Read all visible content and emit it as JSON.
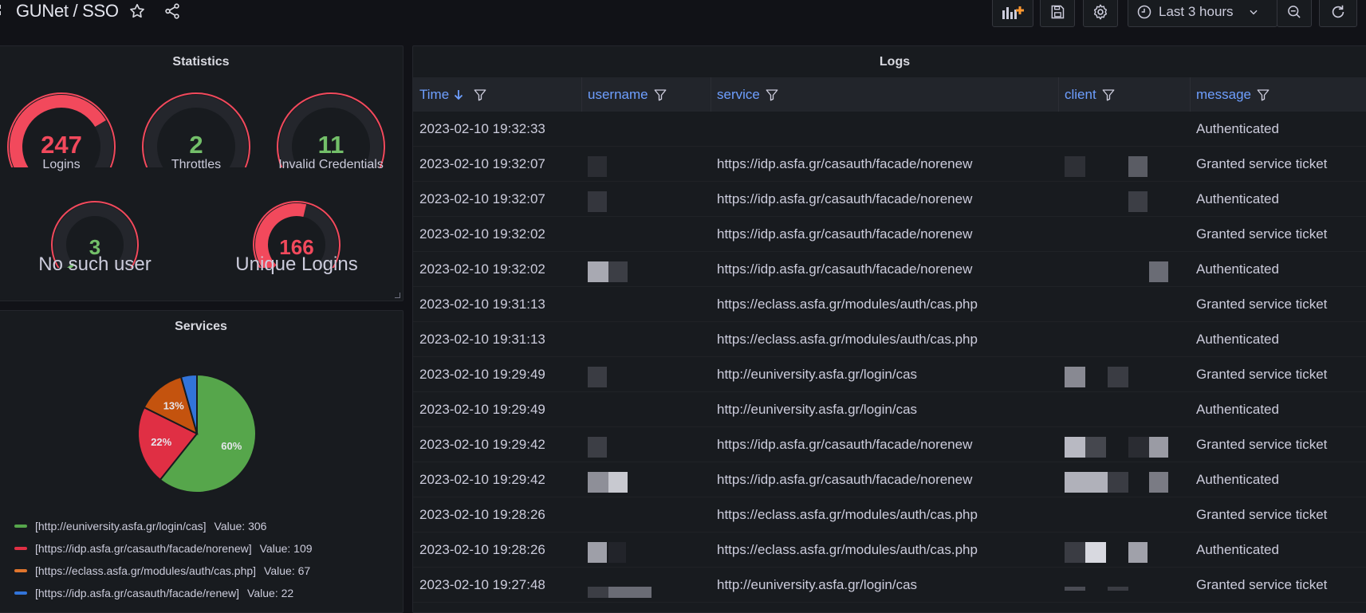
{
  "header": {
    "breadcrumb": "GUNet / SSO",
    "time_range": "Last 3 hours"
  },
  "statistics": {
    "title": "Statistics",
    "gauges": [
      {
        "value": "247",
        "label": "Logins",
        "fill": 0.72,
        "color": "#f2495c"
      },
      {
        "value": "2",
        "label": "Throttles",
        "fill": 0.02,
        "color": "#73bf69"
      },
      {
        "value": "11",
        "label": "Invalid Credentials",
        "fill": 0.05,
        "color": "#73bf69"
      },
      {
        "value": "3",
        "label": "No such user",
        "fill": 0.02,
        "color": "#73bf69"
      },
      {
        "value": "166",
        "label": "Unique Logins",
        "fill": 0.55,
        "color": "#f2495c"
      }
    ]
  },
  "services": {
    "title": "Services",
    "legend": [
      {
        "name": "[http://euniversity.asfa.gr/login/cas]",
        "value": "Value: 306",
        "color": "#56a64b"
      },
      {
        "name": "[https://idp.asfa.gr/casauth/facade/norenew]",
        "value": "Value: 109",
        "color": "#e02f44"
      },
      {
        "name": "[https://eclass.asfa.gr/modules/auth/cas.php]",
        "value": "Value: 67",
        "color": "#e0752d"
      },
      {
        "name": "[https://idp.asfa.gr/casauth/facade/renew]",
        "value": "Value: 22",
        "color": "#3274d9"
      }
    ]
  },
  "chart_data": {
    "type": "pie",
    "categories": [
      "[http://euniversity.asfa.gr/login/cas]",
      "[https://idp.asfa.gr/casauth/facade/norenew]",
      "[https://eclass.asfa.gr/modules/auth/cas.php]",
      "[https://idp.asfa.gr/casauth/facade/renew]"
    ],
    "values": [
      306,
      109,
      67,
      22
    ],
    "slice_labels": [
      "60%",
      "22%",
      "13%",
      ""
    ],
    "colors": [
      "#56a64b",
      "#e02f44",
      "#c4530e",
      "#3274d9"
    ]
  },
  "logs": {
    "title": "Logs",
    "columns": [
      "Time",
      "username",
      "service",
      "client",
      "message"
    ],
    "rows": [
      {
        "time": "2023-02-10 19:32:33",
        "service": "",
        "message": "Authenticated"
      },
      {
        "time": "2023-02-10 19:32:07",
        "service": "https://idp.asfa.gr/casauth/facade/norenew",
        "message": "Granted service ticket"
      },
      {
        "time": "2023-02-10 19:32:07",
        "service": "https://idp.asfa.gr/casauth/facade/norenew",
        "message": "Authenticated"
      },
      {
        "time": "2023-02-10 19:32:02",
        "service": "https://idp.asfa.gr/casauth/facade/norenew",
        "message": "Granted service ticket"
      },
      {
        "time": "2023-02-10 19:32:02",
        "service": "https://idp.asfa.gr/casauth/facade/norenew",
        "message": "Authenticated"
      },
      {
        "time": "2023-02-10 19:31:13",
        "service": "https://eclass.asfa.gr/modules/auth/cas.php",
        "message": "Granted service ticket"
      },
      {
        "time": "2023-02-10 19:31:13",
        "service": "https://eclass.asfa.gr/modules/auth/cas.php",
        "message": "Authenticated"
      },
      {
        "time": "2023-02-10 19:29:49",
        "service": "http://euniversity.asfa.gr/login/cas",
        "message": "Granted service ticket"
      },
      {
        "time": "2023-02-10 19:29:49",
        "service": "http://euniversity.asfa.gr/login/cas",
        "message": "Authenticated"
      },
      {
        "time": "2023-02-10 19:29:42",
        "service": "https://idp.asfa.gr/casauth/facade/norenew",
        "message": "Granted service ticket"
      },
      {
        "time": "2023-02-10 19:29:42",
        "service": "https://idp.asfa.gr/casauth/facade/norenew",
        "message": "Authenticated"
      },
      {
        "time": "2023-02-10 19:28:26",
        "service": "https://eclass.asfa.gr/modules/auth/cas.php",
        "message": "Granted service ticket"
      },
      {
        "time": "2023-02-10 19:28:26",
        "service": "https://eclass.asfa.gr/modules/auth/cas.php",
        "message": "Authenticated"
      },
      {
        "time": "2023-02-10 19:27:48",
        "service": "http://euniversity.asfa.gr/login/cas",
        "message": "Granted service ticket"
      }
    ]
  }
}
